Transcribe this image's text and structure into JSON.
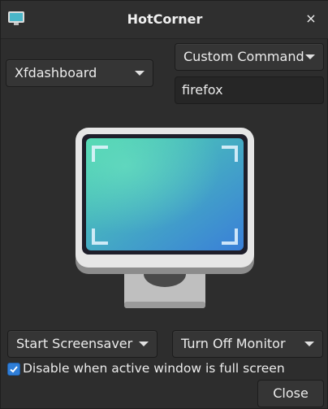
{
  "window": {
    "title": "HotCorner",
    "close_glyph": "×"
  },
  "corners": {
    "top_left": {
      "action": "Xfdashboard"
    },
    "top_right": {
      "action": "Custom Command",
      "command": "firefox"
    },
    "bottom_left": {
      "action": "Start Screensaver"
    },
    "bottom_right": {
      "action": "Turn Off Monitor"
    }
  },
  "options": {
    "disable_fullscreen_label": "Disable when active window is full screen",
    "disable_fullscreen_checked": true
  },
  "buttons": {
    "close_label": "Close"
  },
  "icons": {
    "app": "monitor-icon",
    "preview": "monitor-illustration",
    "close": "close-icon"
  },
  "colors": {
    "background": "#2d2d2d",
    "accent": "#2f7ed8",
    "screen_gradient_start": "#4fd6b0",
    "screen_gradient_end": "#3a7fd8"
  }
}
